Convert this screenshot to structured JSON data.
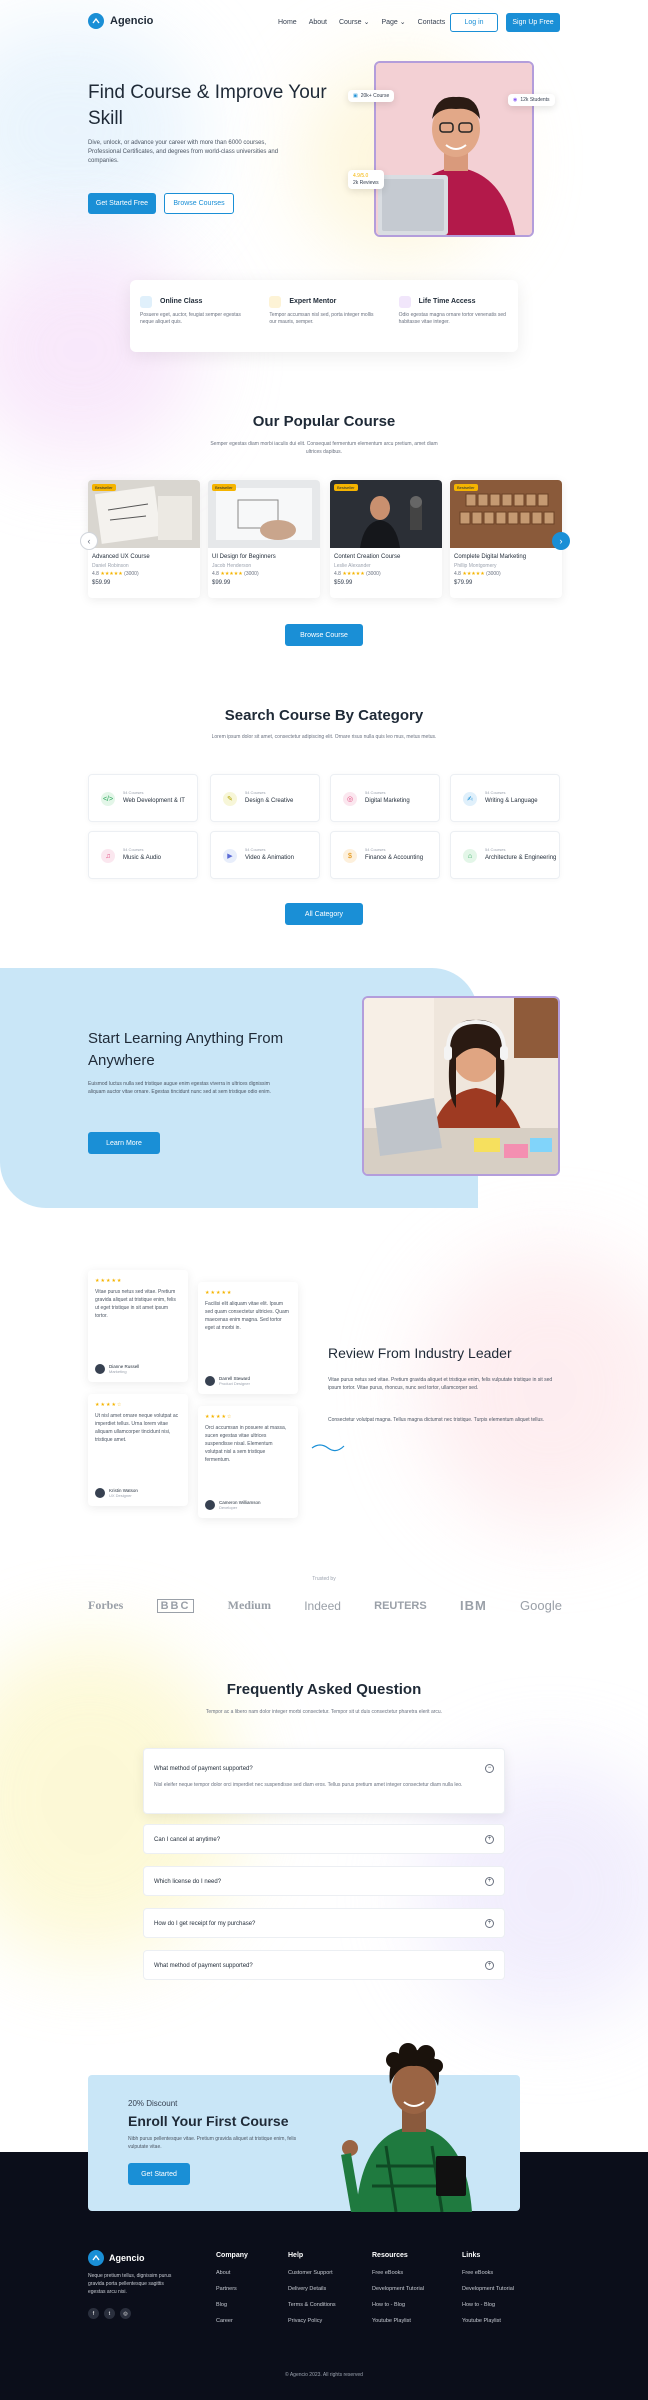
{
  "brand": {
    "name": "Agencio",
    "accent": "#1a8fd6",
    "accent_soft": "#c9e6f7",
    "dark": "#0b0e1a"
  },
  "nav": {
    "links": [
      "Home",
      "About",
      "Course",
      "Page",
      "Contacts"
    ],
    "login": "Log in",
    "signup": "Sign Up Free"
  },
  "hero": {
    "title": "Find Course & Improve Your Skill",
    "description": "Dive, unlock, or advance your career with more than 6000 courses, Professional Certificates, and degrees from world-class universities and companies.",
    "primary_cta": "Get Started Free",
    "secondary_cta": "Browse Courses",
    "badge_top_left": "20k+ Course",
    "badge_top_right": "12k Students",
    "badge_bottom_rating": "4.9/5.0",
    "badge_bottom_label": "2k Reviews"
  },
  "features": [
    {
      "title": "Online Class",
      "desc": "Posuere eget, auctor, feugiat semper egestas neque aliquet quis.",
      "icon": "monitor-icon",
      "color": "#e0f0fb"
    },
    {
      "title": "Expert Mentor",
      "desc": "Tempor accumsan nisl sed, porta integer mollis our mauris, semper.",
      "icon": "mentor-icon",
      "color": "#fdf3d6"
    },
    {
      "title": "Life Time Access",
      "desc": "Odio egestas magna ornare tortor venenatis sed habitasse vitae integer.",
      "icon": "infinity-icon",
      "color": "#f1e6fb"
    }
  ],
  "popular": {
    "title": "Our Popular Course",
    "subtitle": "Semper egestas diam morbi iaculis dui elit. Consequat fermentum elementum arcu pretium, amet diam ultrices dapibus.",
    "browse_label": "Browse Course",
    "courses": [
      {
        "tag": "Bestseller",
        "title": "Advanced UX Course",
        "author": "Daniel Robinson",
        "rating": "4.8",
        "reviews": "(3000)",
        "price": "$59.99"
      },
      {
        "tag": "Bestseller",
        "title": "UI Design for Beginners",
        "author": "Jacob Henderson",
        "rating": "4.8",
        "reviews": "(3000)",
        "price": "$99.99"
      },
      {
        "tag": "Bestseller",
        "title": "Content Creation Course",
        "author": "Leslie Alexander",
        "rating": "4.8",
        "reviews": "(3000)",
        "price": "$59.99"
      },
      {
        "tag": "Bestseller",
        "title": "Complete Digital Marketing",
        "author": "Phillip Montgomery",
        "rating": "4.8",
        "reviews": "(3000)",
        "price": "$79.99"
      }
    ]
  },
  "categories": {
    "title": "Search Course By Category",
    "subtitle": "Lorem ipsum dolor sit amet, consectetur adipiscing elit. Ornare risus nulla quis leo mus, metus metus.",
    "all_label": "All Category",
    "items": [
      {
        "count": "54 Courses",
        "name": "Web Development & IT",
        "color": "#e3f6e8",
        "glyph": "</>"
      },
      {
        "count": "54 Courses",
        "name": "Design & Creative",
        "color": "#f7f6d8",
        "glyph": "✎"
      },
      {
        "count": "54 Courses",
        "name": "Digital Marketing",
        "color": "#fbe7ef",
        "glyph": "◎"
      },
      {
        "count": "54 Courses",
        "name": "Writing & Language",
        "color": "#e0f0fb",
        "glyph": "✍"
      },
      {
        "count": "54 Courses",
        "name": "Music & Audio",
        "color": "#fbe7ef",
        "glyph": "♫"
      },
      {
        "count": "54 Courses",
        "name": "Video & Animation",
        "color": "#e8eefb",
        "glyph": "▶"
      },
      {
        "count": "54 Courses",
        "name": "Finance & Accounting",
        "color": "#fdf0dc",
        "glyph": "$"
      },
      {
        "count": "54 Courses",
        "name": "Architecture & Engineering",
        "color": "#e3f6e8",
        "glyph": "⌂"
      }
    ]
  },
  "learning": {
    "title": "Start Learning Anything From Anywhere",
    "description": "Euismod luctus nulla sed tristique augue enim egestas viverra in ultrices dignissim aliquam auctor vitae ornare. Egestas tincidunt nunc sed at sem tristique odio enim.",
    "cta": "Learn More"
  },
  "reviews": {
    "title": "Review From Industry Leader",
    "desc1": "Vitae purus netus sed vitae. Pretium gravida aliquet et tristique enim, felis vulputate tristique in sit sed ipsum tortor. Vitae purus, rhoncus, nunc sed tortor, ullamcorper sed.",
    "desc2": "Consectetur volutpat magna. Tellus magna dictumst nec tristique. Turpis elementum aliquet tellus.",
    "cards": [
      {
        "stars": "★★★★★",
        "text": "Vitae purus netus sed vitae. Pretium gravida aliquet at tristique enim, felis ut eget tristique in sit amet ipsum tortor.",
        "name": "Dianne Russell",
        "role": "Marketing"
      },
      {
        "stars": "★★★★★",
        "text": "Facilisi elit aliquam vitae elit. Ipsum sed quam consectetur ultricies. Quam maecenas enim magna. Sed tortor eget at morbi in.",
        "name": "Darrell Steward",
        "role": "Product Designer"
      },
      {
        "stars": "★★★★☆",
        "text": "Ut nisl amet ornare neque volutpat ac imperdiet tellus. Urna lorem vitae aliquam ullamcorper tincidunt nisi, tristique amet.",
        "name": "Kristin Watson",
        "role": "UX Designer"
      },
      {
        "stars": "★★★★☆",
        "text": "Orci accumsan in posuere at massa, sucen egestas vitae ultrices suspendisse nisal. Elementum volutpat nisl a sem tristique fermentum.",
        "name": "Cameron Williamson",
        "role": "Developer"
      }
    ]
  },
  "trusted": {
    "label": "Trusted by",
    "logos": [
      "Forbes",
      "BBC",
      "Medium",
      "Indeed",
      "REUTERS",
      "IBM",
      "Google"
    ]
  },
  "faq": {
    "title": "Frequently Asked Question",
    "subtitle": "Tempor ac a libero nam dolor integer morbi consectetur. Tempor sit ut duis consectetur pharetra elerit arcu.",
    "items": [
      {
        "q": "What method of payment supported?",
        "a": "Nisl eleifer neque tempor dolor orci imperdiet nec suspendisse sed diam eros. Tellus purus pretium amet integer consectetur diam nulla leo.",
        "open": true
      },
      {
        "q": "Can I cancel at anytime?",
        "open": false
      },
      {
        "q": "Which license do I need?",
        "open": false
      },
      {
        "q": "How do I get receipt for my purchase?",
        "open": false
      },
      {
        "q": "What method of payment supported?",
        "open": false
      }
    ]
  },
  "enroll": {
    "discount": "20% Discount",
    "title": "Enroll Your First Course",
    "desc": "Nibh purus pellentesque vitae. Pretium gravida aliquet at tristique enim, felis vulputate vitae.",
    "cta": "Get Started"
  },
  "footer": {
    "about": "Neque pretium tellus, dignissim purus gravida porta pellentesque sagittis egestas arcu nisi.",
    "columns": [
      {
        "title": "Company",
        "links": [
          "About",
          "Partners",
          "Blog",
          "Career"
        ]
      },
      {
        "title": "Help",
        "links": [
          "Customer Support",
          "Delivery Details",
          "Terms & Conditions",
          "Privacy Policy"
        ]
      },
      {
        "title": "Resources",
        "links": [
          "Free eBooks",
          "Development Tutorial",
          "How to - Blog",
          "Youtube Playlist"
        ]
      },
      {
        "title": "Links",
        "links": [
          "Free eBooks",
          "Development Tutorial",
          "How to - Blog",
          "Youtube Playlist"
        ]
      }
    ],
    "copyright": "© Agencio 2023. All rights reserved"
  }
}
